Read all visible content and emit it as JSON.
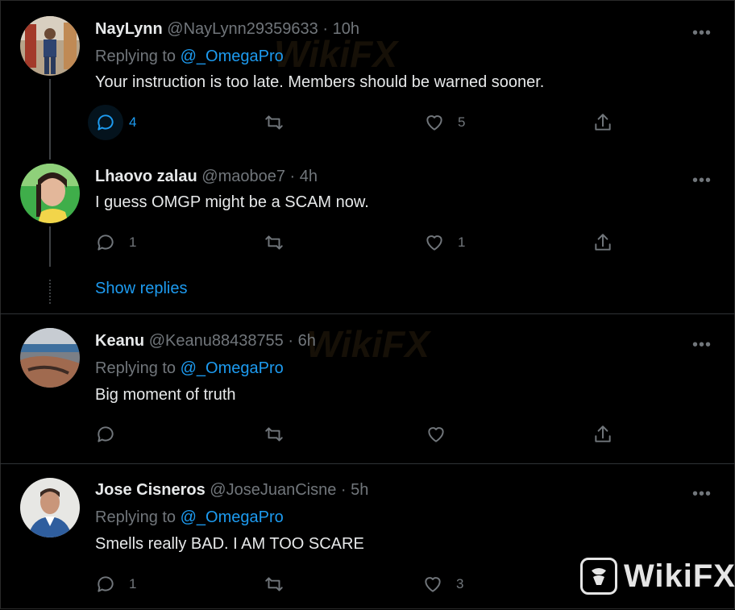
{
  "tweets": [
    {
      "name": "NayLynn",
      "handle": "@NayLynn29359633",
      "separator": "·",
      "time": "10h",
      "replying_prefix": "Replying to ",
      "replying_to": "@_OmegaPro",
      "text": "Your instruction is too late. Members should be warned sooner.",
      "reply_count": "4",
      "like_count": "5"
    },
    {
      "name": "Lhaovo zalau",
      "handle": "@maoboe7",
      "separator": "·",
      "time": "4h",
      "text": "I guess OMGP might be a SCAM now.",
      "reply_count": "1",
      "like_count": "1",
      "show_replies": "Show replies"
    },
    {
      "name": "Keanu",
      "handle": "@Keanu88438755",
      "separator": "·",
      "time": "6h",
      "replying_prefix": "Replying to ",
      "replying_to": "@_OmegaPro",
      "text": "Big moment of truth"
    },
    {
      "name": "Jose Cisneros",
      "handle": "@JoseJuanCisne",
      "separator": "·",
      "time": "5h",
      "replying_prefix": "Replying to ",
      "replying_to": "@_OmegaPro",
      "text": "Smells really BAD. I AM TOO SCARE",
      "reply_count": "1",
      "like_count": "3"
    }
  ],
  "more_glyph": "•••",
  "watermark": {
    "text": "WikiFX"
  },
  "colors": {
    "background": "#000000",
    "accent": "#1d9bf0",
    "muted": "#71767b",
    "text": "#e7e9ea"
  }
}
